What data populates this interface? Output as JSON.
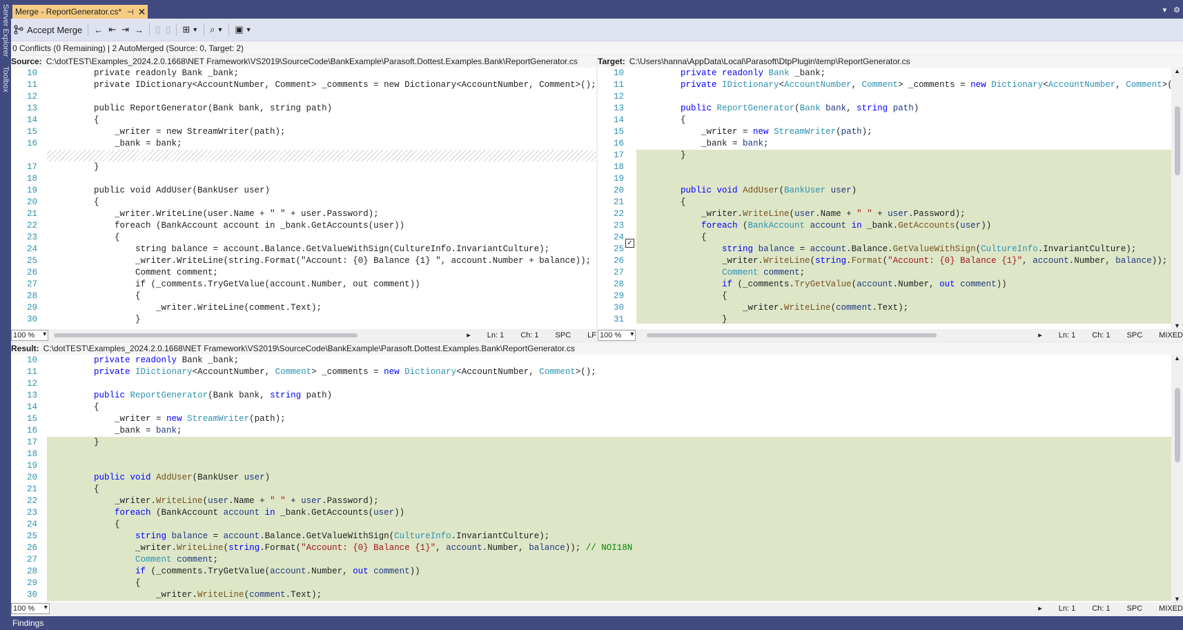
{
  "left_strip": {
    "items": [
      "Server Explorer",
      "Toolbox"
    ]
  },
  "tab": {
    "title": "Merge - ReportGenerator.cs*",
    "pin": "⊣",
    "close": "✕"
  },
  "toolbar": {
    "accept_merge": "Accept Merge"
  },
  "status": "0 Conflicts (0 Remaining) | 2 AutoMerged (Source: 0, Target: 2)",
  "source": {
    "label": "Source:",
    "path": "C:\\dotTEST\\Examples_2024.2.0.1668\\NET Framework\\VS2019\\SourceCode\\BankExample\\Parasoft.Dottest.Examples.Bank\\ReportGenerator.cs",
    "zoom": "100 %",
    "ln": "Ln: 1",
    "ch": "Ch: 1",
    "ws": "SPC",
    "eol": "LF",
    "lines": [
      {
        "n": "10",
        "t": "        private readonly Bank _bank;"
      },
      {
        "n": "11",
        "t": "        private IDictionary<AccountNumber, Comment> _comments = new Dictionary<AccountNumber, Comment>();"
      },
      {
        "n": "12",
        "t": ""
      },
      {
        "n": "13",
        "t": "        public ReportGenerator(Bank bank, string path)"
      },
      {
        "n": "14",
        "t": "        {"
      },
      {
        "n": "15",
        "t": "            _writer = new StreamWriter(path);"
      },
      {
        "n": "16",
        "t": "            _bank = bank;"
      },
      {
        "n": "",
        "t": "",
        "hatch": true
      },
      {
        "n": "17",
        "t": "        }"
      },
      {
        "n": "18",
        "t": ""
      },
      {
        "n": "19",
        "t": "        public void AddUser(BankUser user)"
      },
      {
        "n": "20",
        "t": "        {"
      },
      {
        "n": "21",
        "t": "            _writer.WriteLine(user.Name + \" \" + user.Password);"
      },
      {
        "n": "22",
        "t": "            foreach (BankAccount account in _bank.GetAccounts(user))"
      },
      {
        "n": "23",
        "t": "            {"
      },
      {
        "n": "24",
        "t": "                string balance = account.Balance.GetValueWithSign(CultureInfo.InvariantCulture);"
      },
      {
        "n": "25",
        "t": "                _writer.WriteLine(string.Format(\"Account: {0} Balance {1} \", account.Number + balance)); //"
      },
      {
        "n": "26",
        "t": "                Comment comment;"
      },
      {
        "n": "27",
        "t": "                if (_comments.TryGetValue(account.Number, out comment))"
      },
      {
        "n": "28",
        "t": "                {"
      },
      {
        "n": "29",
        "t": "                    _writer.WriteLine(comment.Text);"
      },
      {
        "n": "30",
        "t": "                }"
      }
    ]
  },
  "target": {
    "label": "Target:",
    "path": "C:\\Users\\hanna\\AppData\\Local\\Parasoft\\DtpPlugin\\temp\\ReportGenerator.cs",
    "zoom": "100 %",
    "ln": "Ln: 1",
    "ch": "Ch: 1",
    "ws": "SPC",
    "eol": "MIXED",
    "checked": "✓",
    "lines": [
      {
        "n": "10",
        "h": "        <span class=\"kw\">private</span> <span class=\"kw\">readonly</span> <span class=\"ty\">Bank</span> _bank;"
      },
      {
        "n": "11",
        "h": "        <span class=\"kw\">private</span> <span class=\"ty\">IDictionary</span>&lt;<span class=\"ty\">AccountNumber</span>, <span class=\"ty\">Comment</span>&gt; _comments = <span class=\"kw\">new</span> <span class=\"ty\">Dictionary</span>&lt;<span class=\"ty\">AccountNumber</span>, <span class=\"ty\">Comment</span>&gt;();"
      },
      {
        "n": "12",
        "h": ""
      },
      {
        "n": "13",
        "h": "        <span class=\"kw\">public</span> <span class=\"ty\">ReportGenerator</span>(<span class=\"ty\">Bank</span> <span class=\"vr\">bank</span>, <span class=\"kw\">string</span> <span class=\"vr\">path</span>)"
      },
      {
        "n": "14",
        "h": "        {"
      },
      {
        "n": "15",
        "h": "            _writer = <span class=\"kw\">new</span> <span class=\"ty\">StreamWriter</span>(<span class=\"vr\">path</span>);"
      },
      {
        "n": "16",
        "h": "            _bank = <span class=\"vr\">bank</span>;"
      },
      {
        "n": "17",
        "h": "        }",
        "hl": true
      },
      {
        "n": "18",
        "h": "",
        "hl": true
      },
      {
        "n": "19",
        "h": "",
        "hl": true
      },
      {
        "n": "20",
        "h": "        <span class=\"kw\">public</span> <span class=\"kw\">void</span> <span class=\"mb\">AddUser</span>(<span class=\"ty\">BankUser</span> <span class=\"vr\">user</span>)",
        "hl": true
      },
      {
        "n": "21",
        "h": "        {",
        "hl": true
      },
      {
        "n": "22",
        "h": "            _writer.<span class=\"mb\">WriteLine</span>(<span class=\"vr\">user</span>.Name + <span class=\"st\">\" \"</span> + <span class=\"vr\">user</span>.Password);",
        "hl": true
      },
      {
        "n": "23",
        "h": "            <span class=\"kw\">foreach</span> (<span class=\"ty\">BankAccount</span> <span class=\"vr\">account</span> <span class=\"kw\">in</span> _bank.<span class=\"mb\">GetAccounts</span>(<span class=\"vr\">user</span>))",
        "hl": true
      },
      {
        "n": "24",
        "h": "            {",
        "hl": true
      },
      {
        "n": "25",
        "h": "                <span class=\"kw\">string</span> <span class=\"vr\">balance</span> = <span class=\"vr\">account</span>.Balance.<span class=\"mb\">GetValueWithSign</span>(<span class=\"ty\">CultureInfo</span>.InvariantCulture);",
        "hl": true
      },
      {
        "n": "26",
        "h": "                _writer.<span class=\"mb\">WriteLine</span>(<span class=\"kw\">string</span>.<span class=\"mb\">Format</span>(<span class=\"st\">\"Account: {0} Balance {1}\"</span>, <span class=\"vr\">account</span>.Number, <span class=\"vr\">balance</span>)); <span class=\"cm\">//</span>",
        "hl": true
      },
      {
        "n": "27",
        "h": "                <span class=\"ty\">Comment</span> <span class=\"vr\">comment</span>;",
        "hl": true
      },
      {
        "n": "28",
        "h": "                <span class=\"kw\">if</span> (_comments.<span class=\"mb\">TryGetValue</span>(<span class=\"vr\">account</span>.Number, <span class=\"kw\">out</span> <span class=\"vr\">comment</span>))",
        "hl": true
      },
      {
        "n": "29",
        "h": "                {",
        "hl": true
      },
      {
        "n": "30",
        "h": "                    _writer.<span class=\"mb\">WriteLine</span>(<span class=\"vr\">comment</span>.Text);",
        "hl": true
      },
      {
        "n": "31",
        "h": "                }",
        "hl": true
      }
    ]
  },
  "result": {
    "label": "Result:",
    "path": "C:\\dotTEST\\Examples_2024.2.0.1668\\NET Framework\\VS2019\\SourceCode\\BankExample\\Parasoft.Dottest.Examples.Bank\\ReportGenerator.cs",
    "zoom": "100 %",
    "ln": "Ln: 1",
    "ch": "Ch: 1",
    "ws": "SPC",
    "eol": "MIXED",
    "lines": [
      {
        "n": "10",
        "h": "        <span class=\"kw\">private</span> <span class=\"kw\">readonly</span> Bank _bank;"
      },
      {
        "n": "11",
        "h": "        <span class=\"kw\">private</span> <span class=\"ty\">IDictionary</span>&lt;AccountNumber, <span class=\"ty\">Comment</span>&gt; _comments = <span class=\"kw\">new</span> <span class=\"ty\">Dictionary</span>&lt;AccountNumber, <span class=\"ty\">Comment</span>&gt;();"
      },
      {
        "n": "12",
        "h": ""
      },
      {
        "n": "13",
        "h": "        <span class=\"kw\">public</span> <span class=\"ty\">ReportGenerator</span>(Bank bank, <span class=\"kw\">string</span> path)"
      },
      {
        "n": "14",
        "h": "        {"
      },
      {
        "n": "15",
        "h": "            _writer = <span class=\"kw\">new</span> <span class=\"ty\">StreamWriter</span>(path);"
      },
      {
        "n": "16",
        "h": "            _bank = <span class=\"vr\">bank</span>;"
      },
      {
        "n": "17",
        "h": "        }",
        "hl": true
      },
      {
        "n": "18",
        "h": "",
        "hl": true
      },
      {
        "n": "19",
        "h": "",
        "hl": true
      },
      {
        "n": "20",
        "h": "        <span class=\"kw\">public</span> <span class=\"kw\">void</span> <span class=\"mb\">AddUser</span>(BankUser <span class=\"vr\">user</span>)",
        "hl": true
      },
      {
        "n": "21",
        "h": "        {",
        "hl": true
      },
      {
        "n": "22",
        "h": "            _writer.<span class=\"mb\">WriteLine</span>(<span class=\"vr\">user</span>.Name + <span class=\"st\">\" \"</span> + <span class=\"vr\">user</span>.Password);",
        "hl": true
      },
      {
        "n": "23",
        "h": "            <span class=\"kw\">foreach</span> (BankAccount <span class=\"vr\">account</span> <span class=\"kw\">in</span> _bank.GetAccounts(<span class=\"vr\">user</span>))",
        "hl": true
      },
      {
        "n": "24",
        "h": "            {",
        "hl": true
      },
      {
        "n": "25",
        "h": "                <span class=\"kw\">string</span> <span class=\"vr\">balance</span> = <span class=\"vr\">account</span>.Balance.GetValueWithSign(<span class=\"ty\">CultureInfo</span>.InvariantCulture);",
        "hl": true
      },
      {
        "n": "26",
        "h": "                _writer.<span class=\"mb\">WriteLine</span>(<span class=\"kw\">string</span>.Format(<span class=\"st\">\"Account: {0} Balance {1}\"</span>, <span class=\"vr\">account</span>.Number, <span class=\"vr\">balance</span>)); <span class=\"cm\">// NOI18N</span>",
        "hl": true
      },
      {
        "n": "27",
        "h": "                <span class=\"ty\">Comment</span> <span class=\"vr\">comment</span>;",
        "hl": true
      },
      {
        "n": "28",
        "h": "                <span class=\"kw\">if</span> (_comments.TryGetValue(<span class=\"vr\">account</span>.Number, <span class=\"kw\">out</span> <span class=\"vr\">comment</span>))",
        "hl": true
      },
      {
        "n": "29",
        "h": "                {",
        "hl": true
      },
      {
        "n": "30",
        "h": "                    _writer.<span class=\"mb\">WriteLine</span>(<span class=\"vr\">comment</span>.Text);",
        "hl": true
      }
    ]
  },
  "findings": {
    "label": "Findings"
  }
}
